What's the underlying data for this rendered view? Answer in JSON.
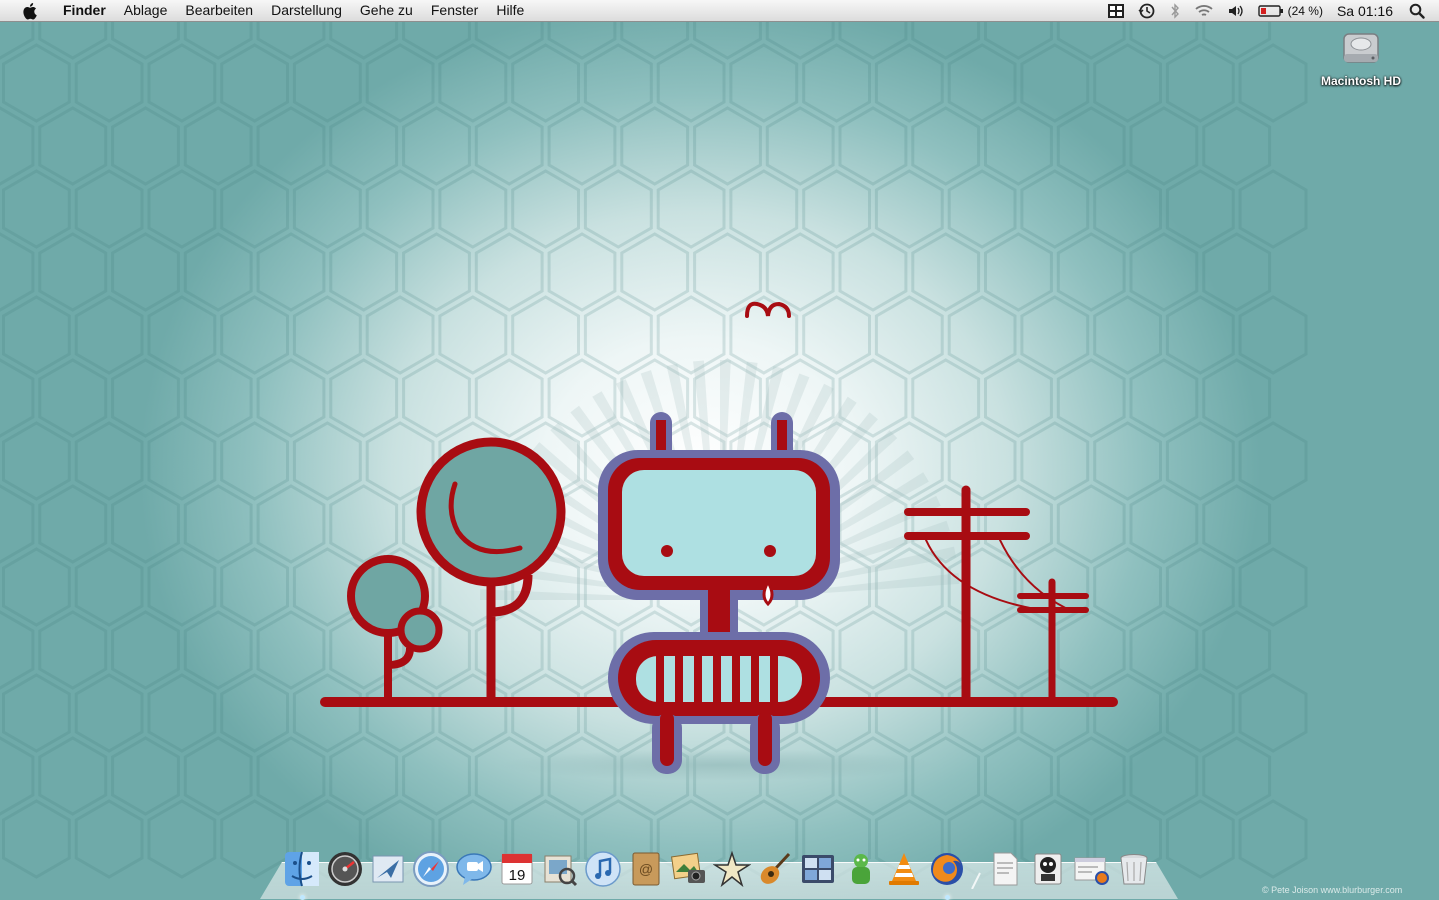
{
  "menubar": {
    "app_name": "Finder",
    "items": [
      "Ablage",
      "Bearbeiten",
      "Darstellung",
      "Gehe zu",
      "Fenster",
      "Hilfe"
    ],
    "battery": "(24 %)",
    "clock": "Sa 01:16"
  },
  "desktop": {
    "hd_label": "Macintosh HD",
    "credit": "© Pete Joison  www.blurburger.com"
  },
  "dock": {
    "calendar_day": "19",
    "apps": [
      "finder",
      "dashboard",
      "mail",
      "safari",
      "ichat",
      "ical",
      "preview",
      "itunes",
      "address-book",
      "iphoto",
      "imovie",
      "garageband",
      "spaces",
      "adium",
      "vlc",
      "firefox"
    ],
    "others": [
      "pdf-document",
      "stack",
      "downloads",
      "trash"
    ]
  },
  "colors": {
    "robot_red": "#a80c12",
    "robot_outline": "#6d6ea8",
    "robot_face": "#aee0e2",
    "tree_fill": "#6fa6a3",
    "background": "#8fc0bf"
  }
}
